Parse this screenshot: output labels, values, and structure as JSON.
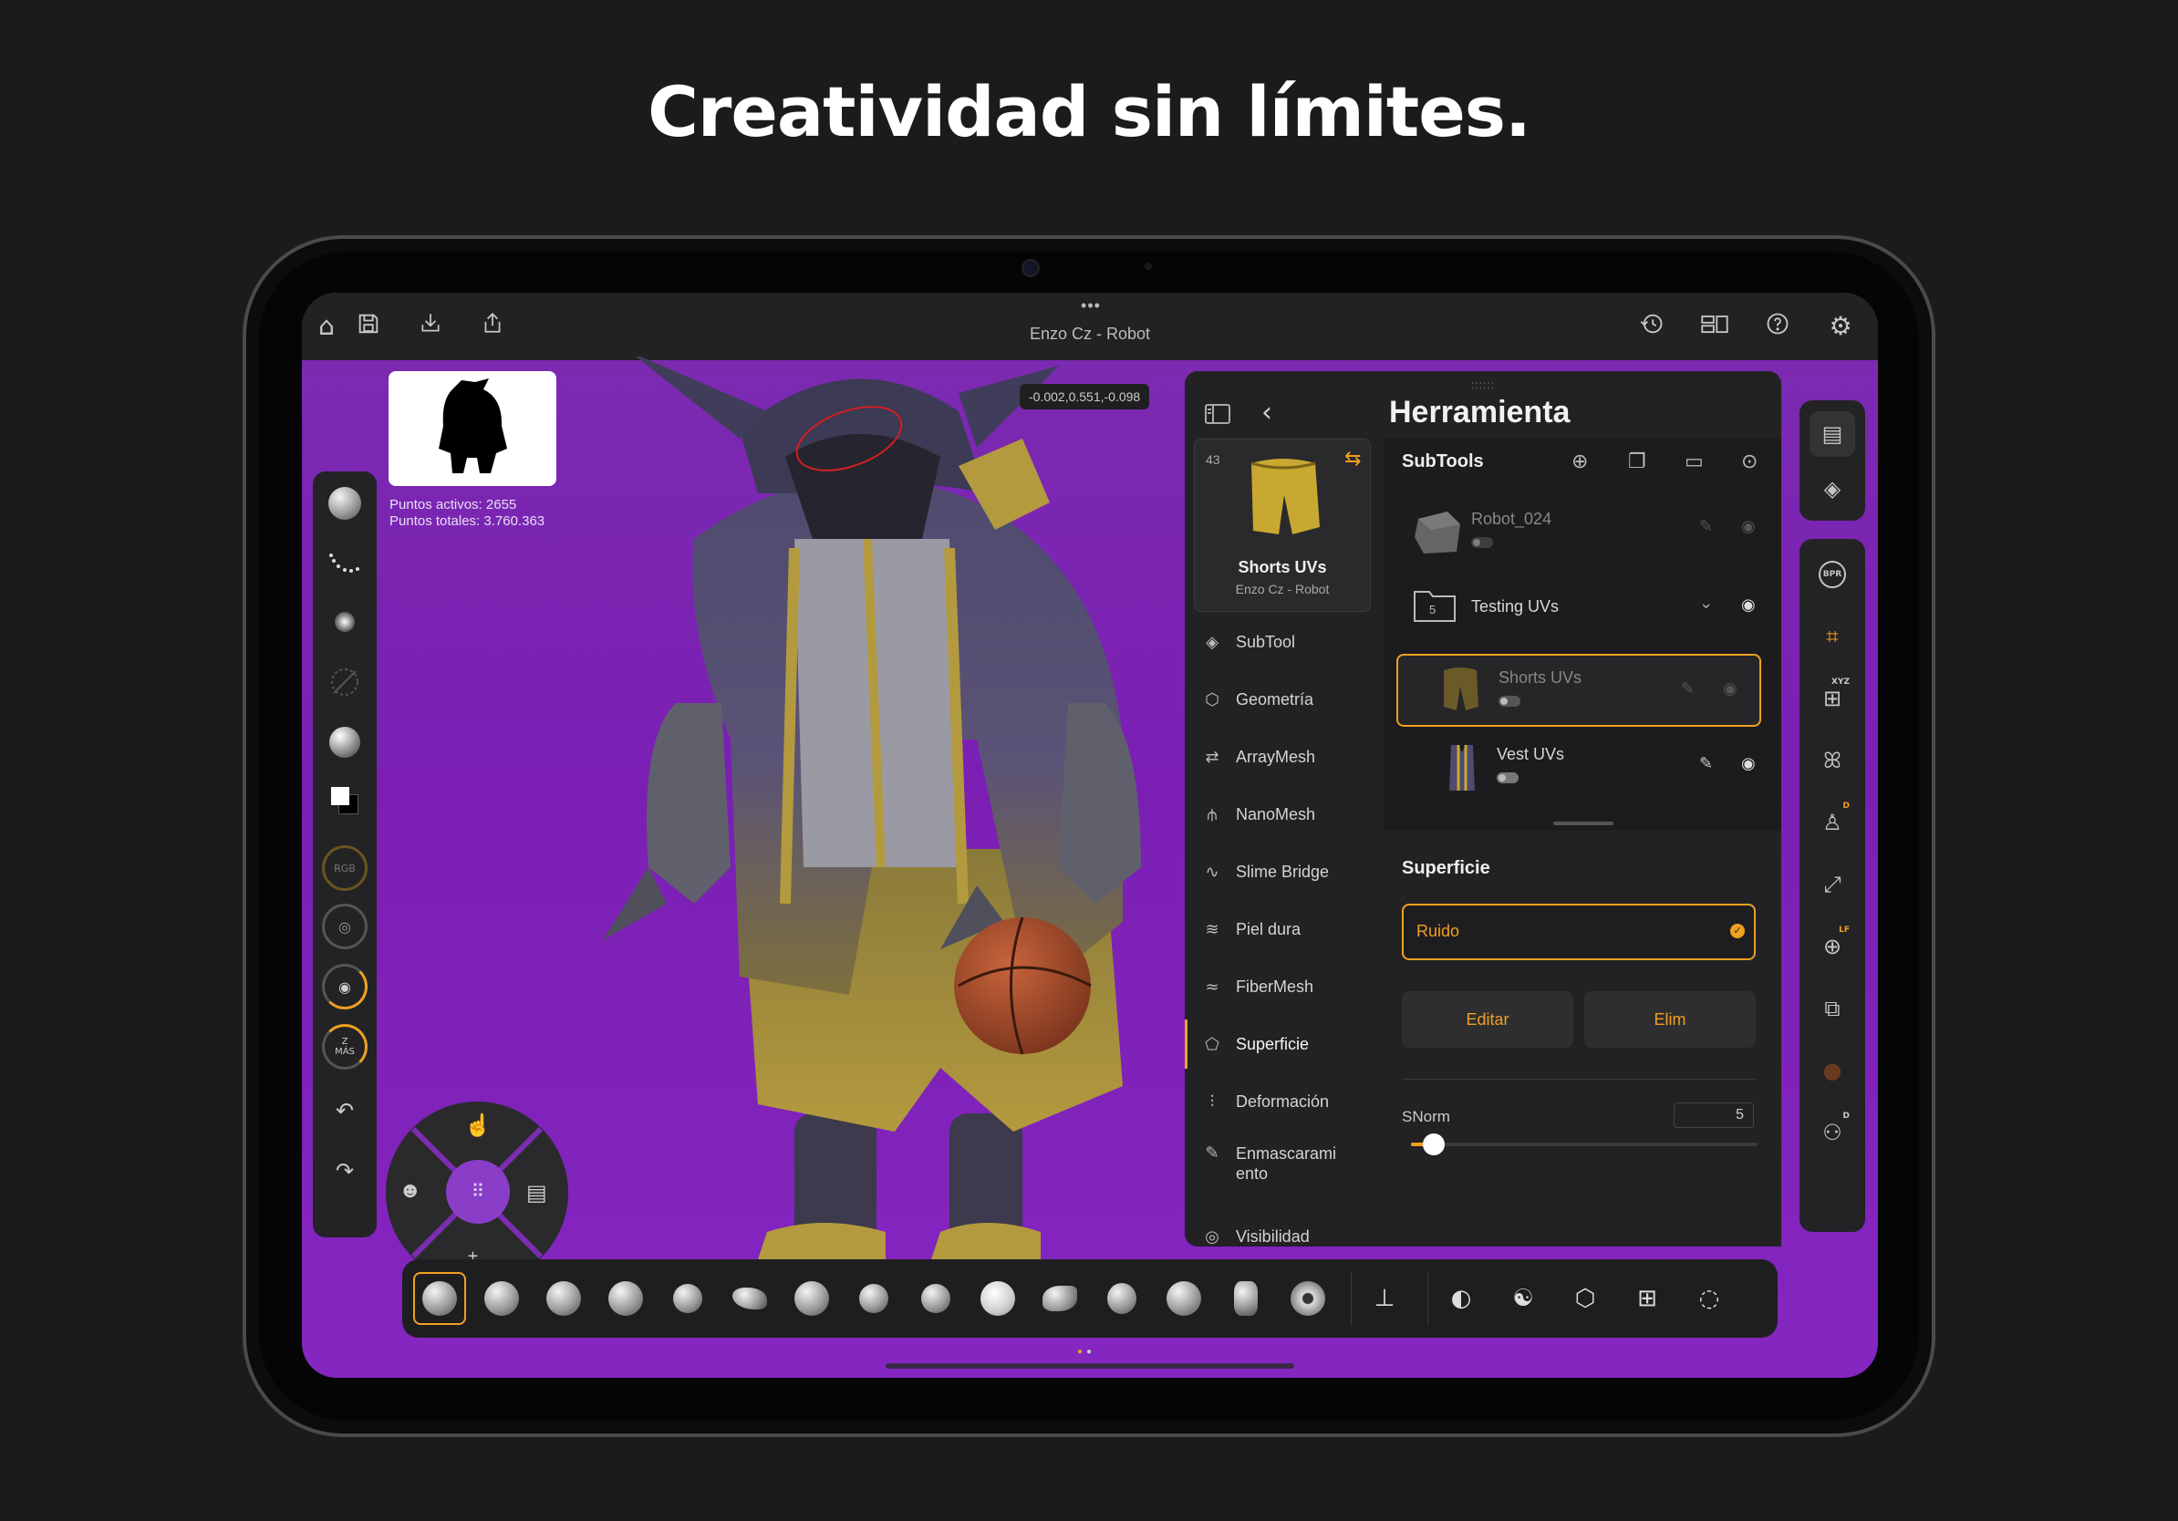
{
  "headline": "Creatividad sin límites.",
  "topbar": {
    "title": "Enzo Cz - Robot",
    "dots": "•••",
    "left_icons": [
      "home-icon",
      "save-icon",
      "import-icon",
      "share-icon"
    ],
    "right_icons": [
      "history-icon",
      "layout-icon",
      "help-icon",
      "settings-icon"
    ]
  },
  "viewport": {
    "active_points": "Puntos activos: 2655",
    "total_points": "Puntos totales: 3.760.363",
    "coords": "-0.002,0.551,-0.098"
  },
  "left_toolbar": {
    "items": [
      "clay-brush-icon",
      "stroke-dots-icon",
      "alpha-icon",
      "disabled-alpha-icon",
      "material-sphere-icon",
      "color-swatch-icon",
      "rgb-icon",
      "focal-icon",
      "draw-size-icon",
      "zadd-icon",
      "undo-icon",
      "redo-icon"
    ],
    "rgb_label": "RGB",
    "zadd_label": "Z\nMÁS"
  },
  "panel": {
    "title": "Herramienta",
    "handle": "::::::",
    "current_tool": {
      "count": "43",
      "name": "Shorts UVs",
      "owner": "Enzo Cz - Robot"
    },
    "nav": [
      {
        "label": "SubTool",
        "icon": "layers-icon"
      },
      {
        "label": "Geometría",
        "icon": "cube-icon"
      },
      {
        "label": "ArrayMesh",
        "icon": "repeat-icon"
      },
      {
        "label": "NanoMesh",
        "icon": "nanomesh-icon"
      },
      {
        "label": "Slime Bridge",
        "icon": "bridge-icon"
      },
      {
        "label": "Piel dura",
        "icon": "waves-icon"
      },
      {
        "label": "FiberMesh",
        "icon": "fiber-icon"
      },
      {
        "label": "Superficie",
        "icon": "surface-icon"
      },
      {
        "label": "Deformación",
        "icon": "deform-icon"
      },
      {
        "label": "Enmascarami\nento",
        "icon": "mask-icon"
      },
      {
        "label": "Visibilidad",
        "icon": "eye-icon"
      }
    ],
    "subtools_header": "SubTools",
    "subtools": [
      {
        "name": "Robot_024",
        "dimmed": true
      },
      {
        "name": "Testing UVs",
        "folder_count": "5"
      },
      {
        "name": "Shorts UVs",
        "selected": true
      },
      {
        "name": "Vest UVs"
      }
    ],
    "section": "Superficie",
    "noise_label": "Ruido",
    "edit_button": "Editar",
    "delete_button": "Elim",
    "snorm_label": "SNorm",
    "snorm_value": "5",
    "snorm_level": 0.05
  },
  "right_toolbar": {
    "items": [
      "tool-list-icon",
      "layers-stack-icon",
      "bpr-icon",
      "move-frame-icon",
      "xyz-grid-icon",
      "symmetry-butterfly-icon",
      "dynamic-icon",
      "frame-expand-icon",
      "perspective-icon",
      "transp-icon",
      "solo-icon",
      "polyframe-icon"
    ],
    "bpr": "BPR",
    "xyz": "XYZ",
    "d": "D",
    "lf": "LF"
  },
  "brush_bar": {
    "items": [
      "clay-buildup",
      "standard",
      "dam-standard",
      "inflate",
      "move",
      "snake-hook",
      "smooth",
      "pinch",
      "trim-dynamic",
      "flatten",
      "hpolish",
      "clay-tubes",
      "polish",
      "hatch",
      "mask-pen",
      "curl"
    ]
  },
  "colors": {
    "accent": "#f0a020",
    "viewport": "#7b2cb0",
    "panel": "#222224"
  }
}
